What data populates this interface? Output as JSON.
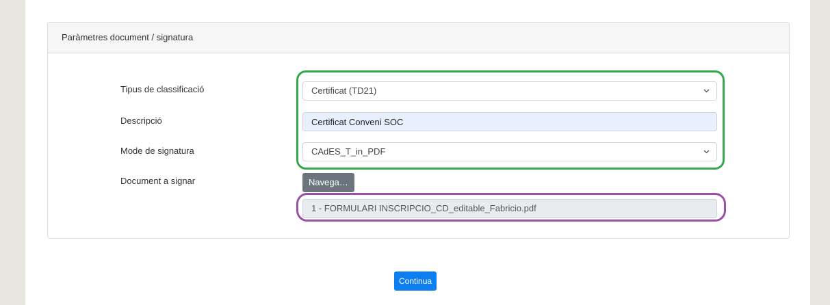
{
  "panel": {
    "title": "Paràmetres document / signatura"
  },
  "form": {
    "classification": {
      "label": "Tipus de classificació",
      "value": "Certificat (TD21)"
    },
    "description": {
      "label": "Descripció",
      "value": "Certificat Conveni SOC"
    },
    "signature_mode": {
      "label": "Mode de signatura",
      "value": "CAdES_T_in_PDF"
    },
    "document": {
      "label": "Document a signar",
      "browse_label": "Navega…",
      "file_name": "1 - FORMULARI INSCRIPCIO_CD_editable_Fabricio.pdf"
    }
  },
  "actions": {
    "continue_label": "Continua"
  },
  "icons": {
    "select_arrow": "chevron-down-icon"
  },
  "colors": {
    "primary": "#0d7ef0",
    "secondary": "#6c757d",
    "highlight_green": "#33a84a",
    "highlight_purple": "#9c4fa6",
    "autofill_input": "#e8f0fe"
  }
}
